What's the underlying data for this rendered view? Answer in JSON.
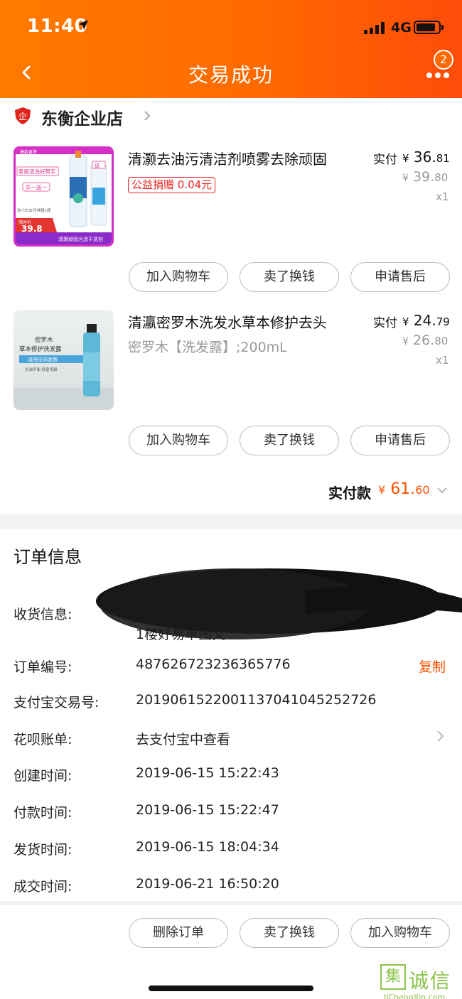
{
  "status": {
    "time": "11:40",
    "network": "4G"
  },
  "header": {
    "title": "交易成功",
    "badge_count": "2"
  },
  "shop": {
    "name": "东衡企业店"
  },
  "products": [
    {
      "title": "清灏去油污清洁剂喷雾去除顽固",
      "donation": "公益捐赠 0.04元",
      "paid_label": "实付",
      "paid_symbol": "¥",
      "paid_int": "36.",
      "paid_dec": "81",
      "orig_symbol": "¥",
      "orig_int": "39.",
      "orig_dec": "80",
      "qty": "x1",
      "image": {
        "top_banner": "爆款直降",
        "left_tag": "家居清洗好帮手",
        "promo": "买一送一",
        "gift": "送",
        "note": "送小白去污神器1瓶",
        "price_tag": "限时价",
        "price": "39.8",
        "bottom": "清灏顽固污渍干洗剂"
      }
    },
    {
      "title": "清瀛密罗木洗发水草本修护去头",
      "spec": "密罗木【洗发露】;200mL",
      "paid_label": "实付",
      "paid_symbol": "¥",
      "paid_int": "24.",
      "paid_dec": "79",
      "orig_symbol": "¥",
      "orig_int": "26.",
      "orig_dec": "80",
      "qty": "x1",
      "image": {
        "line1": "密罗木",
        "line2": "草本修护洗发露",
        "line3": "适用任何发质",
        "line4": "水油平衡  修复毛躁"
      }
    }
  ],
  "product_buttons": {
    "add_cart": "加入购物车",
    "resell": "卖了换钱",
    "after_sale": "申请售后"
  },
  "total": {
    "label": "实付款",
    "symbol": "¥",
    "int": "61.",
    "dec": "60"
  },
  "order_info": {
    "title": "订单信息",
    "address_label": "收货信息:",
    "address_visible": "1楼好易单图文",
    "order_no_label": "订单编号:",
    "order_no": "487626723236365776",
    "copy": "复制",
    "alipay_label": "支付宝交易号:",
    "alipay_no": "2019061522001137041045252726",
    "huabei_label": "花呗账单:",
    "huabei_value": "去支付宝中查看",
    "created_label": "创建时间:",
    "created": "2019-06-15 15:22:43",
    "paid_label": "付款时间:",
    "paid": "2019-06-15 15:22:47",
    "shipped_label": "发货时间:",
    "shipped": "2019-06-15 18:04:34",
    "done_label": "成交时间:",
    "done": "2019-06-21 16:50:20"
  },
  "bottom_bar": {
    "delete": "删除订单",
    "resell": "卖了换钱",
    "add_cart": "加入购物车"
  },
  "watermark": {
    "mark": "集",
    "text": "诚信",
    "url": "JiChengXin.com"
  }
}
